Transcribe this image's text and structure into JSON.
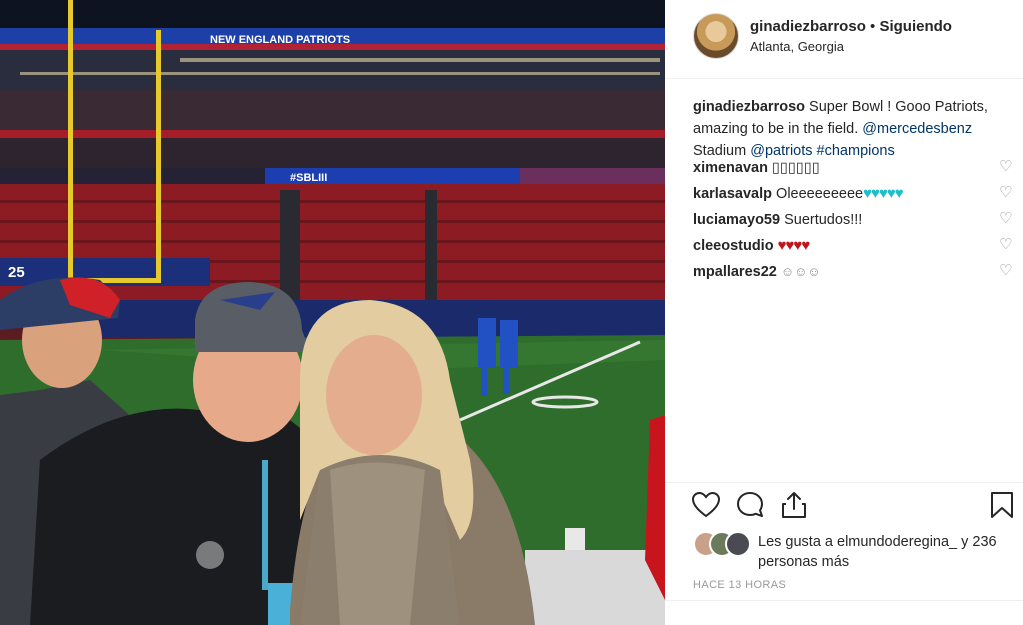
{
  "photo": {
    "stadium_banner": "NEW ENGLAND PATRIOTS",
    "ribbon_text": "#SBLIII",
    "sideline_number": "25",
    "hat_logo": "patriots-logo"
  },
  "header": {
    "username": "ginadiezbarroso",
    "separator": " • ",
    "follow_status": "Siguiendo",
    "location": "Atlanta, Georgia"
  },
  "caption": {
    "username": "ginadiezbarroso",
    "text_1": " Super Bowl ! Gooo Patriots, amazing to be in the field. ",
    "mention_1": "@mercedesbenz",
    "text_2": " Stadium ",
    "mention_2": "@patriots",
    "text_3": " ",
    "hashtag": "#champions"
  },
  "comments": [
    {
      "username": "ximenavan",
      "text": " ▯▯▯▯▯▯"
    },
    {
      "username": "karlasavalp",
      "text": " Oleeeeeeeee"
    },
    {
      "username": "luciamayo59",
      "text": " Suertudos!!!"
    },
    {
      "username": "cleeostudio",
      "text": " "
    },
    {
      "username": "mpallares22",
      "text": " "
    }
  ],
  "actions": {
    "like_icon": "heart-outline-icon",
    "comment_icon": "comment-bubble-icon",
    "share_icon": "share-upload-icon",
    "save_icon": "bookmark-icon"
  },
  "likes": {
    "text": "Les gusta a elmundoderegina_ y 236 personas más"
  },
  "time_ago": "HACE 13 HORAS",
  "colors": {
    "link": "#003569",
    "teal_heart": "#1ebfc8",
    "red_heart": "#c0141c",
    "muted": "#999999"
  }
}
